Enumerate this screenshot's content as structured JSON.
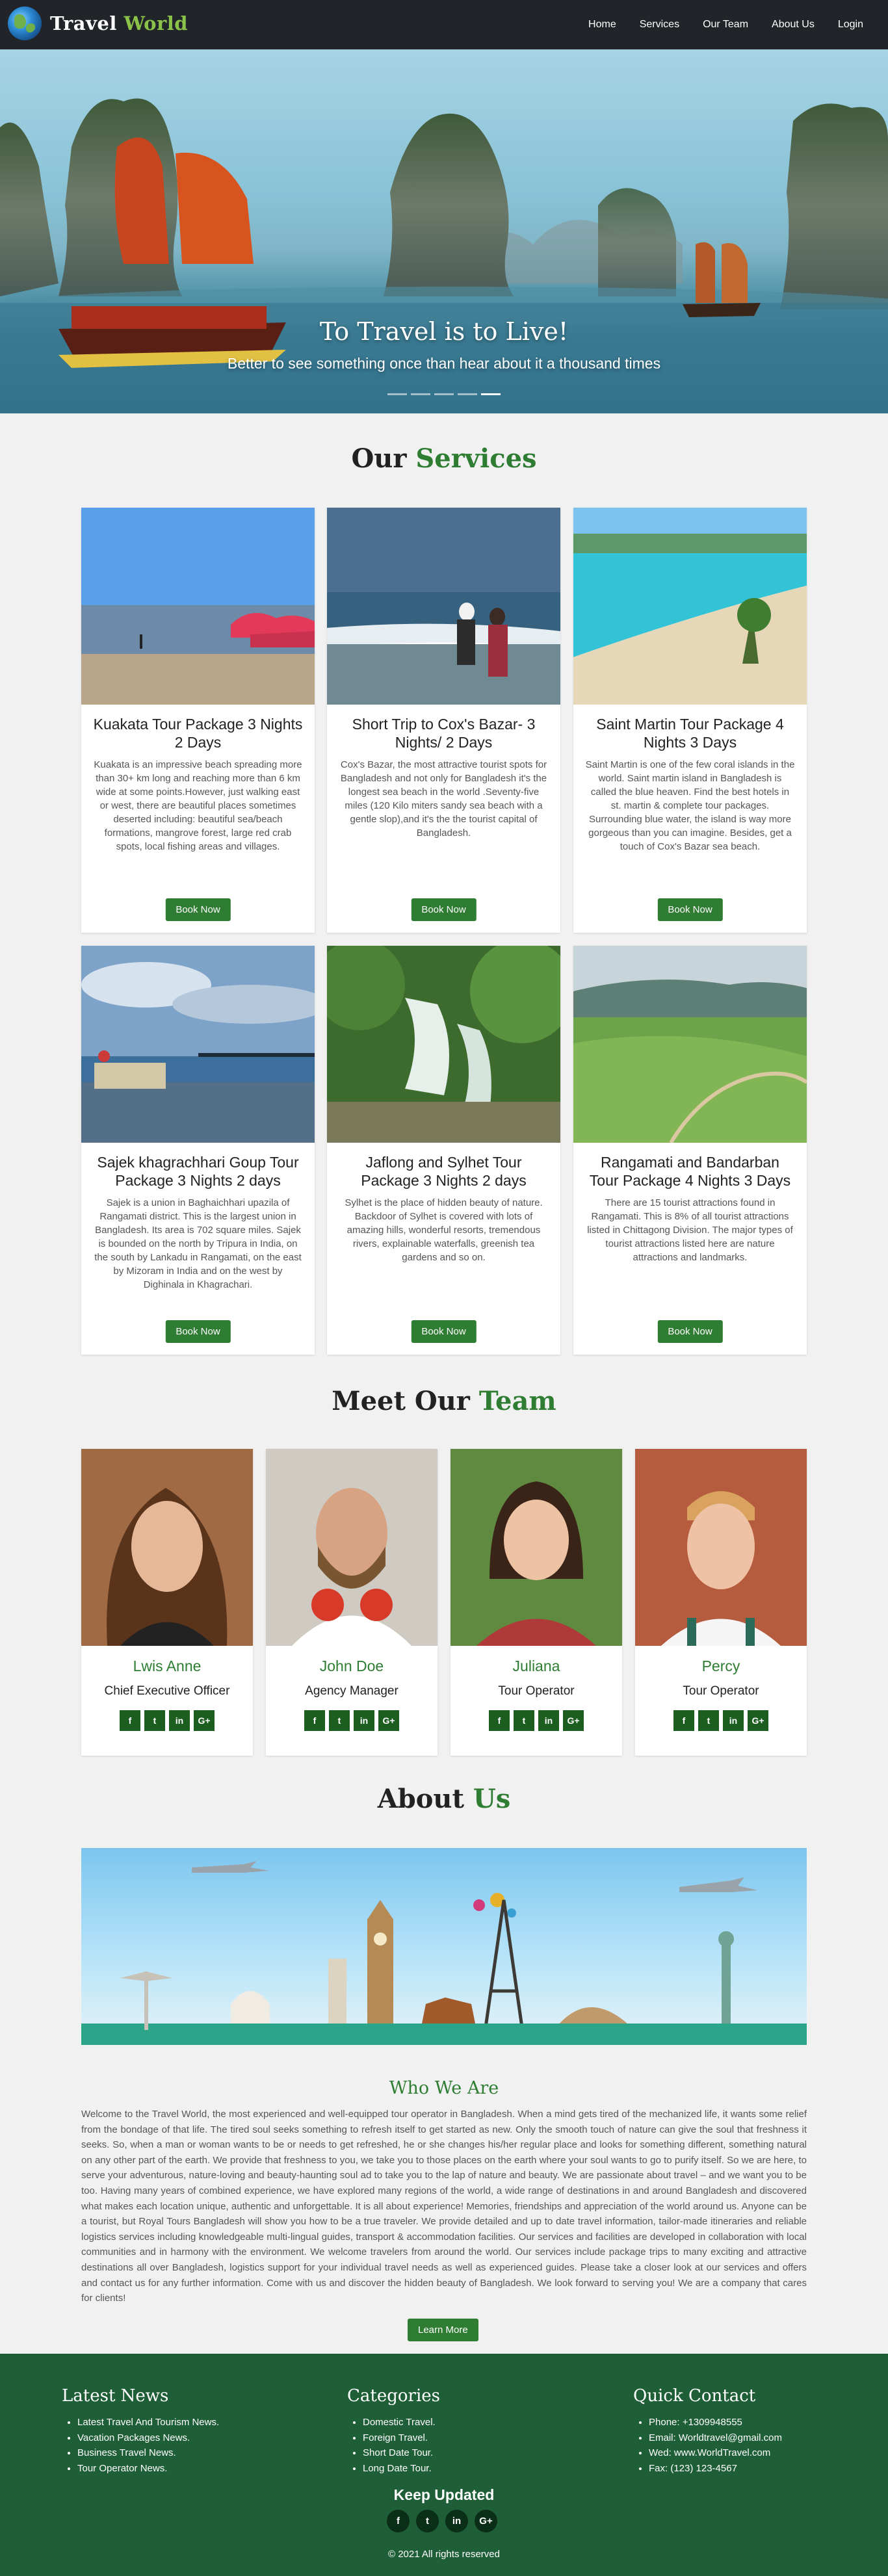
{
  "nav": {
    "brand_first": "Travel",
    "brand_second": "World",
    "links": [
      "Home",
      "Services",
      "Our Team",
      "About Us",
      "Login"
    ]
  },
  "hero": {
    "title": "To Travel is to Live!",
    "subtitle": "Better to see something once than hear about it a thousand times",
    "slides": 5,
    "active_slide": 5
  },
  "services": {
    "title_first": "Our",
    "title_second": "Services",
    "button_label": "Book Now",
    "cards": [
      {
        "title": "Kuakata Tour Package 3 Nights 2 Days",
        "text": "Kuakata is an impressive beach spreading more than 30+ km long and reaching more than 6 km wide at some points.However, just walking east or west, there are beautiful places sometimes deserted including: beautiful sea/beach formations, mangrove forest, large red crab spots, local fishing areas and villages."
      },
      {
        "title": "Short Trip to Cox's Bazar- 3 Nights/ 2 Days",
        "text": "Cox's Bazar, the most attractive tourist spots for Bangladesh and not only for Bangladesh it's the longest sea beach in the world .Seventy-five miles (120 Kilo miters sandy sea beach with a gentle slop),and it's the the tourist capital of Bangladesh."
      },
      {
        "title": "Saint Martin Tour Package 4 Nights 3 Days",
        "text": "Saint Martin is one of the few coral islands in the world. Saint martin island in Bangladesh is called the blue heaven. Find the best hotels in st. martin & complete tour packages. Surrounding blue water, the island is way more gorgeous than you can imagine. Besides, get a touch of Cox's Bazar sea beach."
      },
      {
        "title": "Sajek khagrachhari Goup Tour Package 3 Nights 2 days",
        "text": "Sajek is a union in Baghaichhari upazila of Rangamati district. This is the largest union in Bangladesh. Its area is 702 square miles. Sajek is bounded on the north by Tripura in India, on the south by Lankadu in Rangamati, on the east by Mizoram in India and on the west by Dighinala in Khagrachari."
      },
      {
        "title": "Jaflong and Sylhet Tour Package 3 Nights 2 days",
        "text": "Sylhet is the place of hidden beauty of nature. Backdoor of Sylhet is covered with lots of amazing hills, wonderful resorts, tremendous rivers, explainable waterfalls, greenish tea gardens and so on."
      },
      {
        "title": "Rangamati and Bandarban Tour Package 4 Nights 3 Days",
        "text": "There are 15 tourist attractions found in Rangamati. This is 8% of all tourist attractions listed in Chittagong Division. The major types of tourist attractions listed here are nature attractions and landmarks."
      }
    ]
  },
  "team": {
    "title_first": "Meet Our",
    "title_second": "Team",
    "members": [
      {
        "name": "Lwis Anne",
        "role": "Chief Executive Officer"
      },
      {
        "name": "John Doe",
        "role": "Agency Manager"
      },
      {
        "name": "Juliana",
        "role": "Tour Operator"
      },
      {
        "name": "Percy",
        "role": "Tour Operator"
      }
    ],
    "social_icons": [
      "f",
      "t",
      "in",
      "G+"
    ]
  },
  "about": {
    "title_first": "About",
    "title_second": "Us",
    "subtitle": "Who We Are",
    "text": "Welcome to the Travel World, the most experienced and well-equipped tour operator in Bangladesh. When a mind gets tired of the mechanized life, it wants some relief from the bondage of that life. The tired soul seeks something to refresh itself to get started as new. Only the smooth touch of nature can give the soul that freshness it seeks. So, when a man or woman wants to be or needs to get refreshed, he or she changes his/her regular place and looks for something different, something natural on any other part of the earth. We provide that freshness to you, we take you to those places on the earth where your soul wants to go to purify itself. So we are here, to serve your adventurous, nature-loving and beauty-haunting soul ad to take you to the lap of nature and beauty. We are passionate about travel – and we want you to be too. Having many years of combined experience, we have explored many regions of the world, a wide range of destinations in and around Bangladesh and discovered what makes each location unique, authentic and unforgettable. It is all about experience! Memories, friendships and appreciation of the world around us. Anyone can be a tourist, but Royal Tours Bangladesh will show you how to be a true traveler. We provide detailed and up to date travel information, tailor-made itineraries and reliable logistics services including knowledgeable multi-lingual guides, transport & accommodation facilities. Our services and facilities are developed in collaboration with local communities and in harmony with the environment. We welcome travelers from around the world. Our services include package trips to many exciting and attractive destinations all over Bangladesh, logistics support for your individual travel needs as well as experienced guides. Please take a closer look at our services and offers and contact us for any further information. Come with us and discover the hidden beauty of Bangladesh. We look forward to serving you! We are a company that cares for clients!",
    "button_label": "Learn More"
  },
  "footer": {
    "news_title": "Latest News",
    "news": [
      "Latest Travel And Tourism News.",
      "Vacation Packages News.",
      "Business Travel News.",
      "Tour Operator News."
    ],
    "categories_title": "Categories",
    "categories": [
      "Domestic Travel.",
      "Foreign Travel.",
      "Short Date Tour.",
      "Long Date Tour."
    ],
    "contact_title": "Quick Contact",
    "contact": [
      "Phone: +1309948555",
      "Email: Worldtravel@gmail.com",
      "Wed: www.WorldTravel.com",
      "Fax: (123) 123-4567"
    ],
    "keep_updated": "Keep Updated",
    "social_icons": [
      "f",
      "t",
      "in",
      "G+"
    ],
    "copyright": "© 2021 All rights reserved"
  }
}
